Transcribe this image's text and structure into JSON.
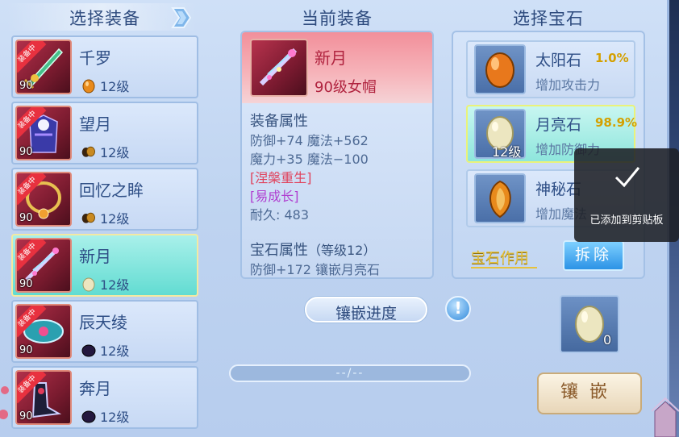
{
  "titles": {
    "left": "选择装备",
    "center": "当前装备",
    "right": "选择宝石"
  },
  "equipment_list": [
    {
      "name": "千罗",
      "badge": "装备中",
      "level": "90",
      "gem_level": "12级",
      "gem_color": "#e88a1c",
      "selected": false
    },
    {
      "name": "望月",
      "badge": "装备中",
      "level": "90",
      "gem_level": "12级",
      "gem_color": "#8a5a10",
      "selected": false
    },
    {
      "name": "回忆之眸",
      "badge": "装备中",
      "level": "90",
      "gem_level": "12级",
      "gem_color": "#8a5a10",
      "selected": false
    },
    {
      "name": "新月",
      "badge": "装备中",
      "level": "90",
      "gem_level": "12级",
      "gem_color": "#e8e2b8",
      "selected": true
    },
    {
      "name": "辰天绫",
      "badge": "装备中",
      "level": "90",
      "gem_level": "12级",
      "gem_color": "#2a1f4a",
      "selected": false
    },
    {
      "name": "奔月",
      "badge": "装备中",
      "level": "90",
      "gem_level": "12级",
      "gem_color": "#2a1f4a",
      "selected": false
    }
  ],
  "current": {
    "name": "新月",
    "subtitle": "90级女帽",
    "attr_title": "装备属性",
    "attr_lines": [
      "防御+74 魔法+562",
      "魔力+35 魔法−100"
    ],
    "special_1": "[涅槃重生]",
    "special_2": "[易成长]",
    "durability": "耐久: 483",
    "gem_attr_title": "宝石属性",
    "gem_attr_level": "（等级12）",
    "gem_attr_line": "防御+172 镶嵌月亮石"
  },
  "gems": [
    {
      "name": "太阳石",
      "rate": "1.0%",
      "desc": "增加攻击力",
      "count": "",
      "selected": false,
      "color": "#e8781c"
    },
    {
      "name": "月亮石",
      "rate": "98.9%",
      "desc": "增加防御力",
      "count": "12级",
      "selected": true,
      "color": "#e8e2b8"
    },
    {
      "name": "神秘石",
      "rate": "",
      "desc": "增加魔法",
      "count": "",
      "selected": false,
      "color": "#e8881c"
    }
  ],
  "gem_use_label": "宝石作用",
  "unmount_label": "拆除",
  "progress": {
    "label": "镶嵌进度",
    "text": "--/--",
    "fraction": 0.0
  },
  "info_label": "!",
  "slot": {
    "count": "0",
    "color": "#e8e2b8"
  },
  "inlay_label": "镶嵌",
  "toast": {
    "text": "已添加到剪贴板"
  }
}
